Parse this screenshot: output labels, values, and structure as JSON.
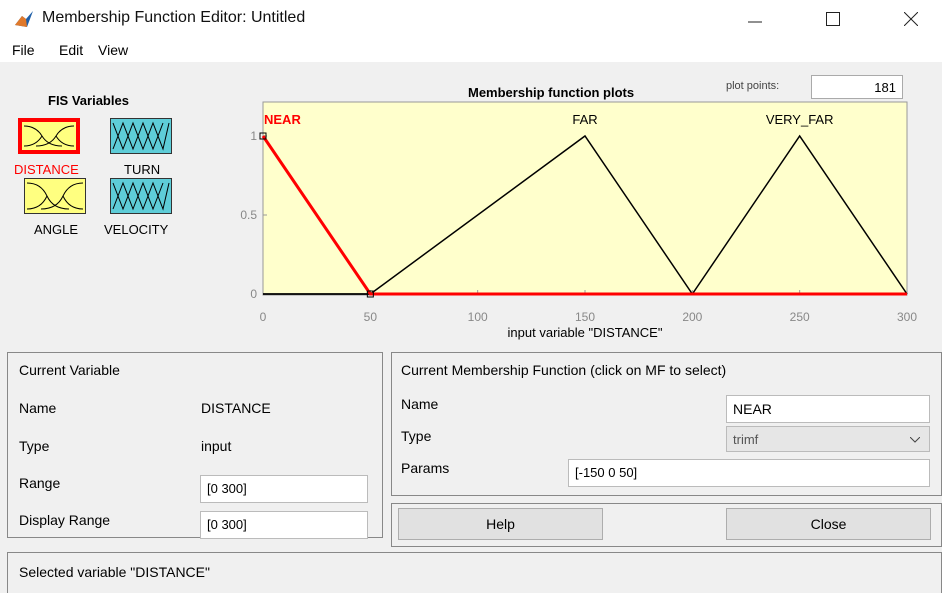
{
  "window": {
    "title": "Membership Function Editor: Untitled"
  },
  "menu": [
    "File",
    "Edit",
    "View"
  ],
  "fis_variables": {
    "heading": "FIS Variables",
    "items": [
      {
        "name": "DISTANCE",
        "kind": "input",
        "selected": true
      },
      {
        "name": "TURN",
        "kind": "output",
        "selected": false
      },
      {
        "name": "ANGLE",
        "kind": "input",
        "selected": false
      },
      {
        "name": "VELOCITY",
        "kind": "output",
        "selected": false
      }
    ]
  },
  "plot": {
    "title": "Membership function plots",
    "plot_points_label": "plot points:",
    "plot_points": "181",
    "xlabel": "input variable \"DISTANCE\"",
    "x_ticks": [
      "0",
      "50",
      "100",
      "150",
      "200",
      "250",
      "300"
    ],
    "y_ticks": [
      "0",
      "0.5",
      "1"
    ]
  },
  "chart_data": {
    "type": "line",
    "xlim": [
      0,
      300
    ],
    "ylim": [
      0,
      1
    ],
    "grid": false,
    "series": [
      {
        "name": "NEAR",
        "params": [
          -150,
          0,
          50
        ],
        "selected": true,
        "x": [
          0,
          50,
          300
        ],
        "y": [
          1,
          0,
          0
        ]
      },
      {
        "name": "FAR",
        "params": [
          50,
          150,
          200
        ],
        "selected": false,
        "x": [
          0,
          50,
          150,
          200,
          300
        ],
        "y": [
          0,
          0,
          1,
          0,
          0
        ]
      },
      {
        "name": "VERY_FAR",
        "params": [
          200,
          250,
          300
        ],
        "selected": false,
        "x": [
          0,
          200,
          250,
          300
        ],
        "y": [
          0,
          0,
          1,
          0
        ]
      }
    ],
    "colors": {
      "background": "#ffffcc",
      "selected": "#ff0000",
      "normal": "#000000"
    }
  },
  "current_variable": {
    "heading": "Current Variable",
    "name_label": "Name",
    "name_value": "DISTANCE",
    "type_label": "Type",
    "type_value": "input",
    "range_label": "Range",
    "range_value": "[0 300]",
    "display_range_label": "Display Range",
    "display_range_value": "[0 300]"
  },
  "current_mf": {
    "heading": "Current Membership Function (click on MF to select)",
    "name_label": "Name",
    "name_value": "NEAR",
    "type_label": "Type",
    "type_value": "trimf",
    "params_label": "Params",
    "params_value": "[-150 0 50]"
  },
  "buttons": {
    "help": "Help",
    "close": "Close"
  },
  "status": "Selected variable \"DISTANCE\""
}
